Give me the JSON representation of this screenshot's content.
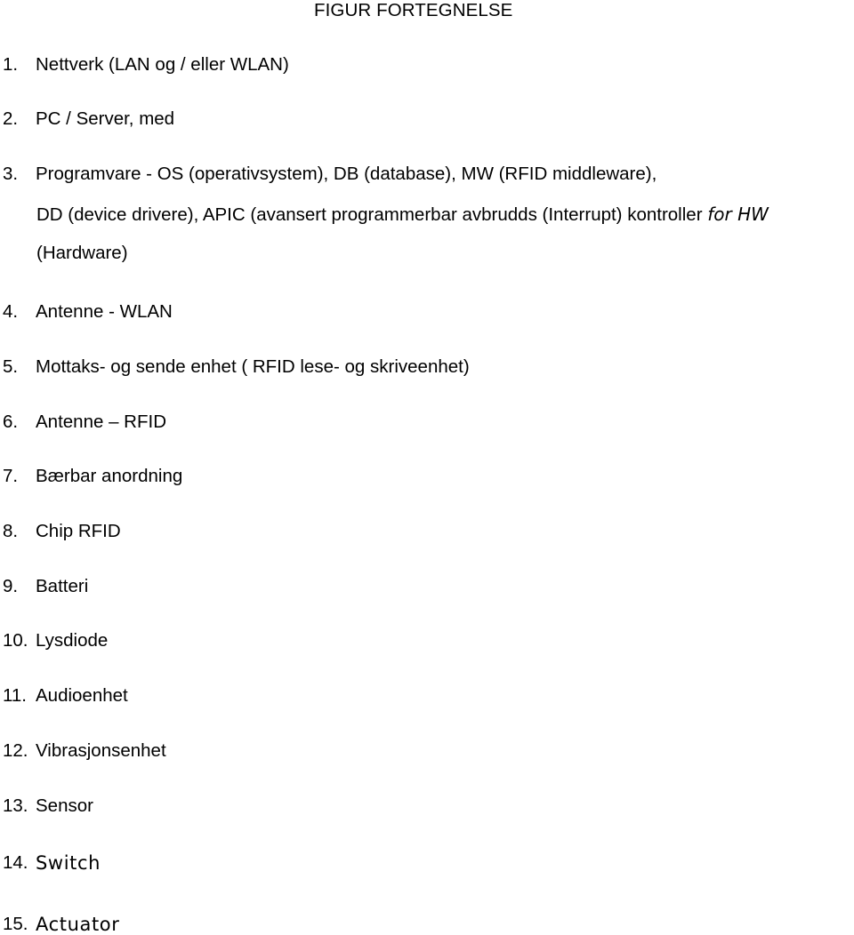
{
  "document": {
    "title": "FIGUR FORTEGNELSE",
    "items": [
      {
        "number": "1.",
        "text": "Nettverk (LAN og / eller WLAN)"
      },
      {
        "number": "2.",
        "text": "PC / Server, med"
      },
      {
        "number": "3.",
        "text": "Programvare - OS (operativsystem), DB (database), MW (RFID middleware),",
        "continuation": "DD (device drivere), APIC (avansert programmerbar avbrudds (Interrupt) kontroller ",
        "continuation_italic": "for HW",
        "continuation2": "(Hardware)"
      },
      {
        "number": "4.",
        "text": "Antenne - WLAN"
      },
      {
        "number": "5.",
        "text": "Mottaks- og sende enhet ( RFID lese- og skriveenhet)"
      },
      {
        "number": "6.",
        "text": "Antenne – RFID"
      },
      {
        "number": "7.",
        "text": "Bærbar anordning"
      },
      {
        "number": "8.",
        "text": "Chip RFID"
      },
      {
        "number": "9.",
        "text": "Batteri"
      },
      {
        "number": "10.",
        "text": "Lysdiode"
      },
      {
        "number": "11.",
        "text": "Audioenhet"
      },
      {
        "number": "12.",
        "text": "Vibrasjonsenhet"
      },
      {
        "number": "13.",
        "text": "Sensor"
      },
      {
        "number": "14.",
        "text": "Switch"
      },
      {
        "number": "15.",
        "text": "Actuator"
      }
    ]
  }
}
